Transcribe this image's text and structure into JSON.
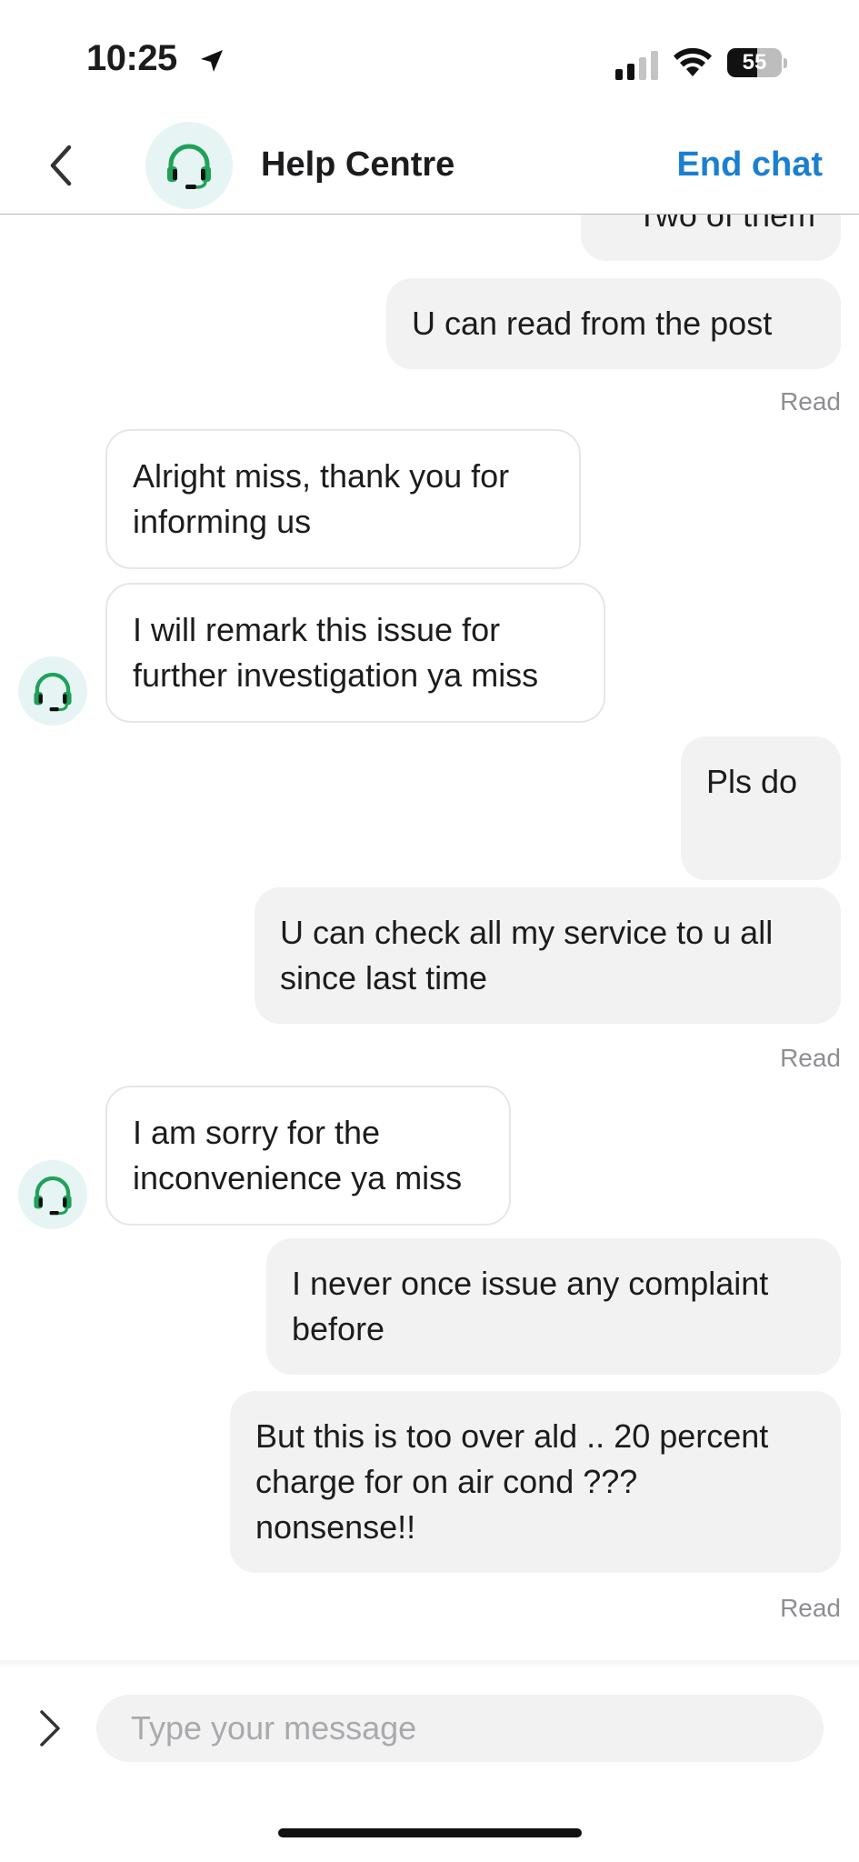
{
  "status_bar": {
    "time": "10:25",
    "battery": "55"
  },
  "header": {
    "title": "Help Centre",
    "end_chat_label": "End chat"
  },
  "messages": [
    {
      "from": "user",
      "text": "Two of them",
      "status": ""
    },
    {
      "from": "user",
      "text": "U can read from the post",
      "status": "Read"
    },
    {
      "from": "agent",
      "lines": [
        "Alright miss, thank you for",
        "informing us"
      ]
    },
    {
      "from": "agent",
      "lines": [
        "I will remark this issue for",
        "further investigation ya miss"
      ]
    },
    {
      "from": "user",
      "text": "Pls do",
      "status": ""
    },
    {
      "from": "user",
      "lines": [
        "U can check all my service to u all",
        "since last time"
      ],
      "status": "Read"
    },
    {
      "from": "agent",
      "lines": [
        "I am sorry for the",
        "inconvenience ya miss"
      ]
    },
    {
      "from": "user",
      "lines": [
        "I never once issue any complaint",
        "before"
      ],
      "status": ""
    },
    {
      "from": "user",
      "lines": [
        "But this is too over ald .. 20 percent",
        "charge for on air cond ???",
        "nonsense!!"
      ],
      "status": "Read"
    }
  ],
  "composer": {
    "placeholder": "Type your message"
  },
  "colors": {
    "accent": "#1a7fd0",
    "agent_icon": "#1fa15a",
    "avatar_bg": "#e6f5f3",
    "outgoing_bubble": "#f2f2f2"
  },
  "icons": {
    "back": "chevron-left-icon",
    "agent": "headset-icon",
    "expand": "chevron-right-icon"
  }
}
